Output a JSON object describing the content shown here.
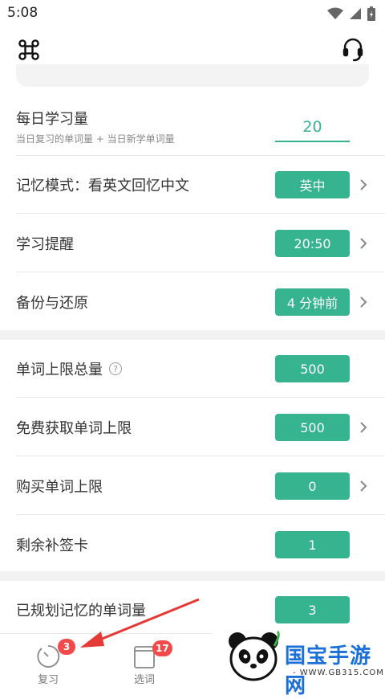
{
  "status_bar": {
    "time": "5:08"
  },
  "settings": {
    "daily": {
      "label": "每日学习量",
      "sub": "当日复习的单词量 + 当日新学单词量",
      "value": "20"
    },
    "rows1": [
      {
        "label": "记忆模式：看英文回忆中文",
        "value": "英中",
        "arrow": true
      },
      {
        "label": "学习提醒",
        "value": "20:50",
        "arrow": true
      },
      {
        "label": "备份与还原",
        "value": "4 分钟前",
        "arrow": true
      }
    ],
    "rows2": [
      {
        "label": "单词上限总量",
        "value": "500",
        "help": "?",
        "arrow": false
      },
      {
        "label": "免费获取单词上限",
        "value": "500",
        "arrow": true
      },
      {
        "label": "购买单词上限",
        "value": "0",
        "arrow": true
      },
      {
        "label": "剩余补签卡",
        "value": "1",
        "arrow": false
      }
    ],
    "rows3": [
      {
        "label": "已规划记忆的单词量",
        "value": "3",
        "arrow": false
      }
    ]
  },
  "bottom_nav": {
    "review": {
      "label": "复习",
      "badge": "3"
    },
    "select": {
      "label": "选词",
      "badge": "17"
    }
  },
  "watermark": {
    "title": "国宝手游网",
    "url": "- WWW.GB315.COM -"
  },
  "colors": {
    "accent": "#36b38f",
    "badge": "#f04a4a",
    "arrow": "#e53935"
  }
}
